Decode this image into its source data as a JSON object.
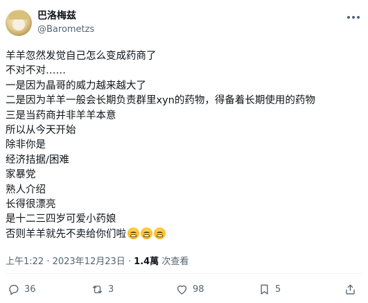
{
  "user": {
    "name": "巴洛梅兹",
    "handle": "@Barometzs"
  },
  "post": {
    "lines": [
      "羊羊忽然发觉自己怎么变成药商了",
      "不对不对……",
      "一是因为晶哥的威力越来越大了",
      "二是因为羊羊一般会长期负责群里xyn的药物，得备着长期使用的药物",
      "三是当药商并非羊羊本意",
      "所以从今天开始",
      "除非你是",
      "经济拮据/困难",
      "家暴党",
      "熟人介绍",
      "长得很漂亮",
      "是十二三四岁可爱小药娘",
      "否则羊羊就先不卖给你们啦"
    ],
    "emoji": "tired-face-emoji"
  },
  "meta": {
    "time": "上午1:22 · 2023年12月23日 · ",
    "views_count": "1.4萬",
    "views_label": " 次查看"
  },
  "actions": {
    "replies": "36",
    "reposts": "3",
    "likes": "98",
    "bookmarks": "5"
  },
  "colors": {
    "text": "#0f1419",
    "secondary": "#536471",
    "divider": "#eff3f4"
  }
}
